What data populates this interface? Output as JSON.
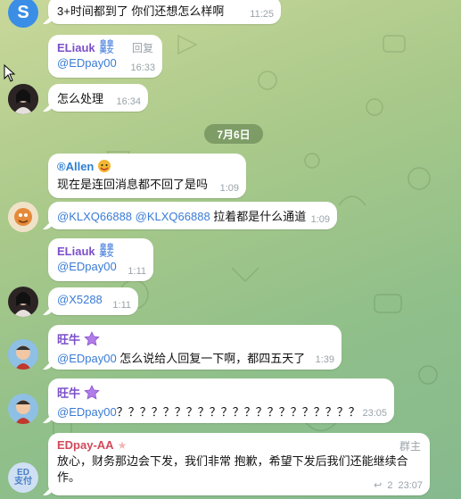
{
  "colors": {
    "purple_name": "#7b4fc9",
    "blue_name": "#2f7fd1",
    "red_name": "#d2495a",
    "mention": "#3a7bd5",
    "timestamp": "#9aa3a9"
  },
  "date_separator": "7月6日",
  "messages": [
    {
      "text": "3+时间都到了 你们还想怎么样啊",
      "time": "11:25",
      "avatar": "S"
    },
    {
      "sender": "ELiauk",
      "badge": "皇皇美女",
      "side_label": "回复",
      "mention": "@EDpay00",
      "time": "16:33"
    },
    {
      "text": "怎么处理",
      "time": "16:34"
    },
    {
      "sender": "®Allen",
      "text": "现在是连回消息都不回了是吗",
      "time": "1:09"
    },
    {
      "mentions": "@KLXQ66888 @KLXQ66888",
      "text": " 拉着都是什么通道",
      "time": "1:09"
    },
    {
      "sender": "ELiauk",
      "badge": "皇皇美女",
      "mention": "@EDpay00",
      "time": "1:11"
    },
    {
      "mention": "@X5288",
      "time": "1:11"
    },
    {
      "sender": "旺牛",
      "mention": "@EDpay00",
      "text": " 怎么说给人回复一下啊，都四五天了",
      "time": "1:39"
    },
    {
      "sender": "旺牛",
      "mention": "@EDpay00",
      "text": "？？？？？？？？？？？？？？？？？？？？？",
      "time": "23:05"
    },
    {
      "sender": "EDpay-AA",
      "role": "群主",
      "text": "放心，财务那边会下发，我们非常 抱歉，希望下发后我们还能继续合作。",
      "replies": "2",
      "time": "23:07",
      "avatar": "ED 支付"
    }
  ]
}
